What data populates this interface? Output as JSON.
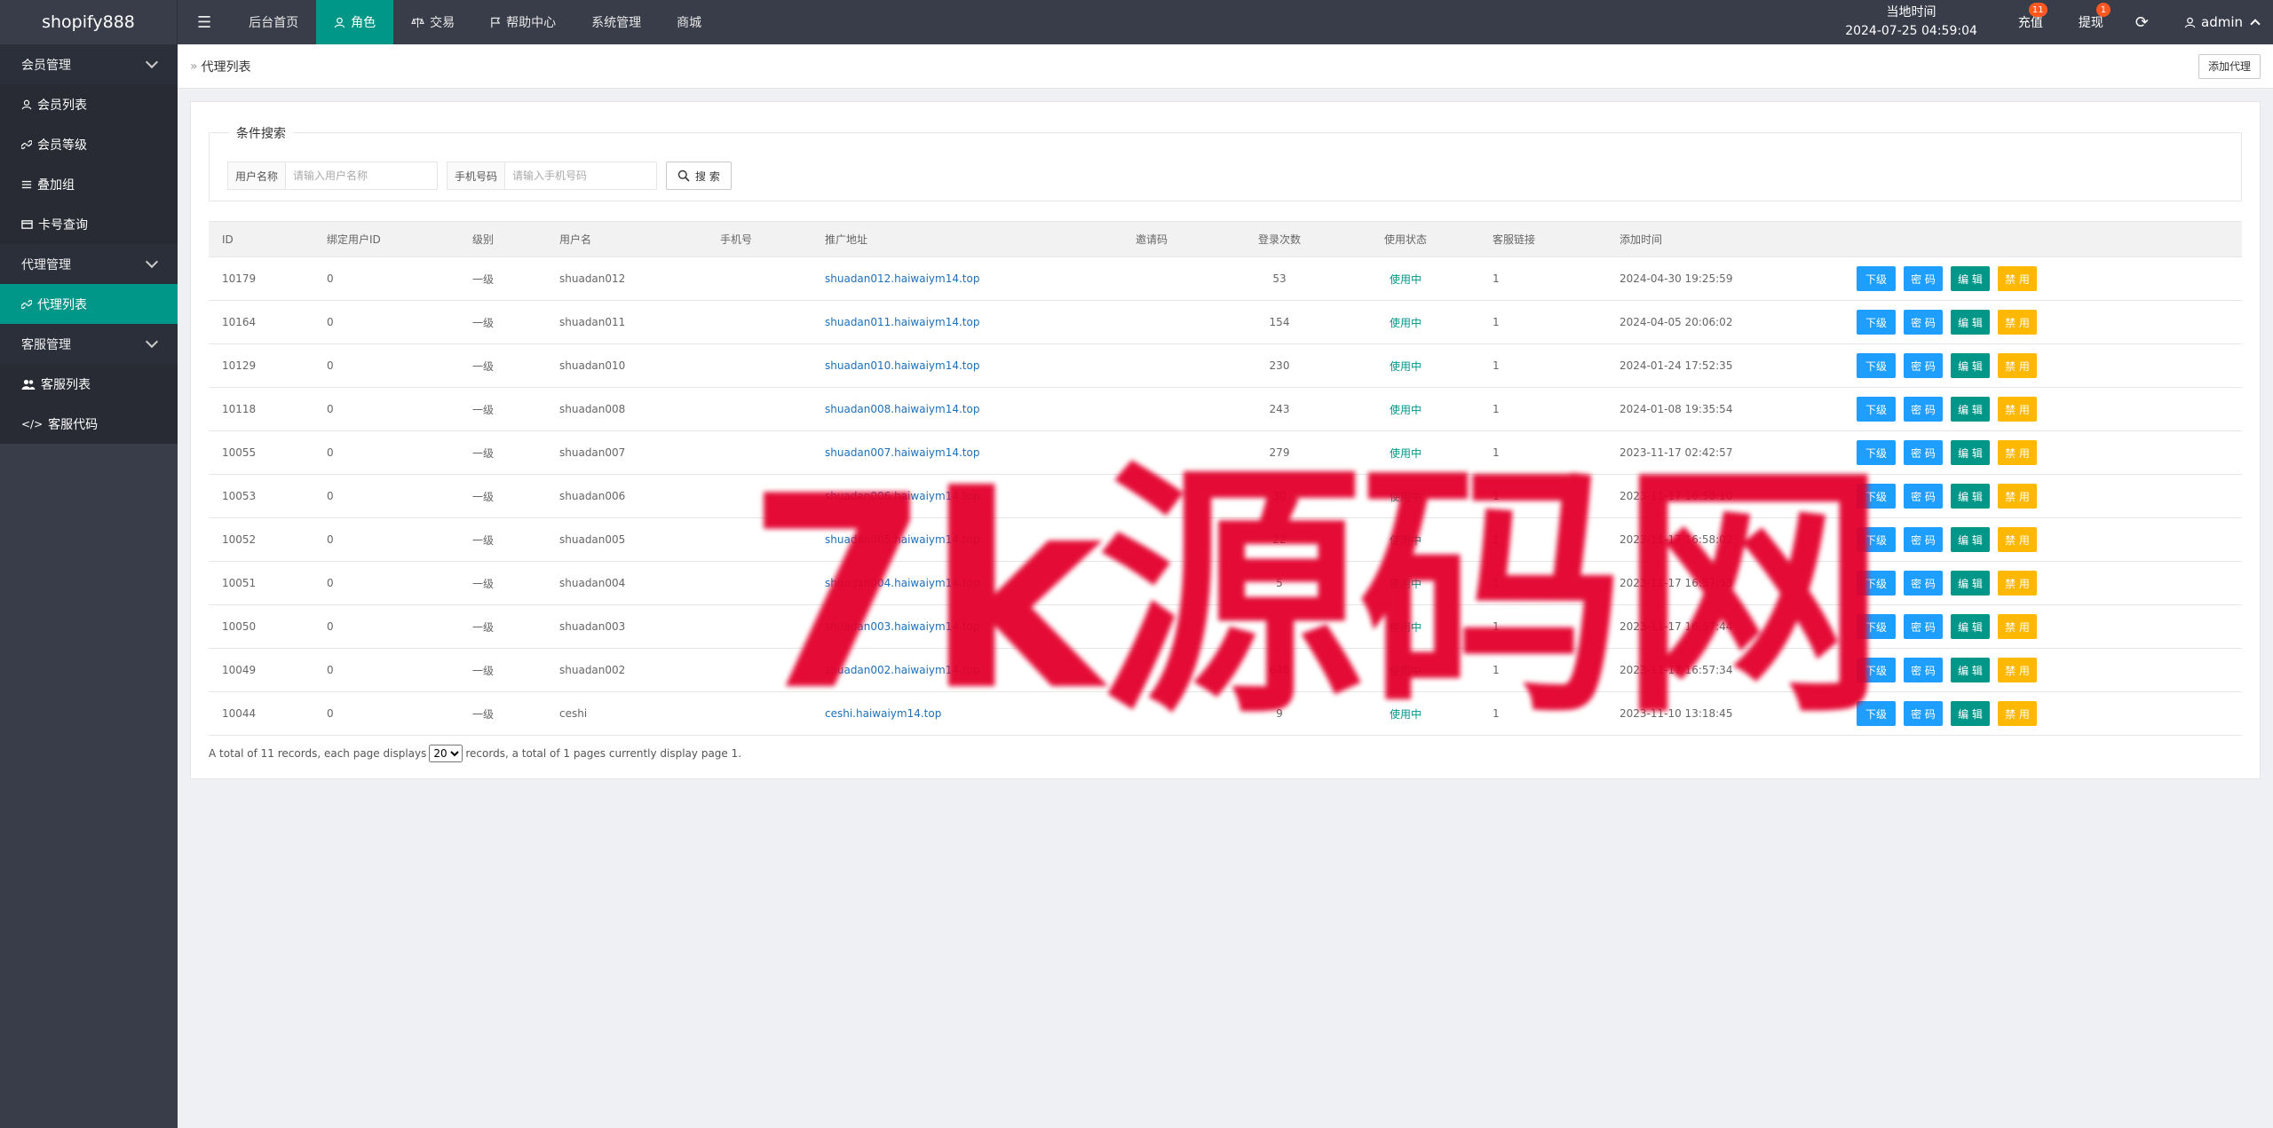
{
  "header": {
    "logo": "shopify888",
    "nav": [
      {
        "label": "后台首页",
        "icon": ""
      },
      {
        "label": "角色",
        "icon": "user-icon"
      },
      {
        "label": "交易",
        "icon": "scale-icon"
      },
      {
        "label": "帮助中心",
        "icon": "flag-icon"
      },
      {
        "label": "系统管理",
        "icon": ""
      },
      {
        "label": "商城",
        "icon": ""
      }
    ],
    "clock_label": "当地时间",
    "clock_value": "2024-07-25 04:59:04",
    "recharge_label": "充值",
    "recharge_badge": "11",
    "withdraw_label": "提现",
    "withdraw_badge": "1",
    "user_label": "admin"
  },
  "sidebar": {
    "groups": [
      {
        "label": "会员管理",
        "items": [
          "会员列表",
          "会员等级",
          "叠加组",
          "卡号查询"
        ]
      },
      {
        "label": "代理管理",
        "items": [
          "代理列表"
        ]
      },
      {
        "label": "客服管理",
        "items": [
          "客服列表",
          "客服代码"
        ]
      }
    ]
  },
  "page": {
    "breadcrumb": "代理列表",
    "add_button": "添加代理",
    "search_legend": "条件搜索",
    "username_label": "用户名称",
    "username_placeholder": "请输入用户名称",
    "phone_label": "手机号码",
    "phone_placeholder": "请输入手机号码",
    "search_button": "搜 索"
  },
  "table": {
    "columns": [
      "ID",
      "绑定用户ID",
      "级别",
      "用户名",
      "手机号",
      "推广地址",
      "邀请码",
      "登录次数",
      "使用状态",
      "客服链接",
      "添加时间",
      ""
    ],
    "rows": [
      [
        "10179",
        "0",
        "一级",
        "shuadan012",
        "",
        "shuadan012.haiwaiym14.top",
        "",
        "53",
        "使用中",
        "1",
        "2024-04-30 19:25:59"
      ],
      [
        "10164",
        "0",
        "一级",
        "shuadan011",
        "",
        "shuadan011.haiwaiym14.top",
        "",
        "154",
        "使用中",
        "1",
        "2024-04-05 20:06:02"
      ],
      [
        "10129",
        "0",
        "一级",
        "shuadan010",
        "",
        "shuadan010.haiwaiym14.top",
        "",
        "230",
        "使用中",
        "1",
        "2024-01-24 17:52:35"
      ],
      [
        "10118",
        "0",
        "一级",
        "shuadan008",
        "",
        "shuadan008.haiwaiym14.top",
        "",
        "243",
        "使用中",
        "1",
        "2024-01-08 19:35:54"
      ],
      [
        "10055",
        "0",
        "一级",
        "shuadan007",
        "",
        "shuadan007.haiwaiym14.top",
        "",
        "279",
        "使用中",
        "1",
        "2023-11-17 02:42:57"
      ],
      [
        "10053",
        "0",
        "一级",
        "shuadan006",
        "",
        "shuadan006.haiwaiym14.top",
        "",
        "30",
        "使用中",
        "1",
        "2023-11-17 16:58:10"
      ],
      [
        "10052",
        "0",
        "一级",
        "shuadan005",
        "",
        "shuadan005.haiwaiym14.top",
        "",
        "22",
        "使用中",
        "1",
        "2023-11-17 16:58:02"
      ],
      [
        "10051",
        "0",
        "一级",
        "shuadan004",
        "",
        "shuadan004.haiwaiym14.top",
        "",
        "5",
        "使用中",
        "1",
        "2023-11-17 16:57:53"
      ],
      [
        "10050",
        "0",
        "一级",
        "shuadan003",
        "",
        "shuadan003.haiwaiym14.top",
        "",
        "",
        "使用中",
        "1",
        "2023-11-17 16:57:44"
      ],
      [
        "10049",
        "0",
        "一级",
        "shuadan002",
        "",
        "shuadan002.haiwaiym14.top",
        "",
        "648",
        "使用中",
        "1",
        "2023-11-17 16:57:34"
      ],
      [
        "10044",
        "0",
        "一级",
        "ceshi",
        "",
        "ceshi.haiwaiym14.top",
        "",
        "9",
        "使用中",
        "1",
        "2023-11-10 13:18:45"
      ]
    ],
    "actions": [
      "下级",
      "密 码",
      "编 辑",
      "禁 用"
    ]
  },
  "pager": {
    "prefix": "A total of 11 records, each page displays",
    "page_size": "20",
    "suffix": "records, a total of 1 pages currently display page 1."
  },
  "watermark": "7k源码网",
  "colors": {
    "header_bg": "#393d49",
    "accent": "#009688",
    "blue": "#1e9fff",
    "yellow": "#ffb800"
  }
}
